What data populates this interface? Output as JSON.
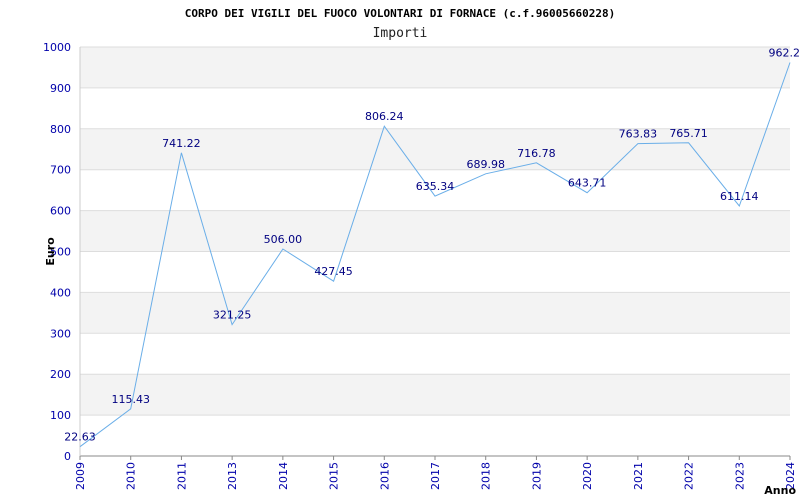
{
  "chart_data": {
    "type": "line",
    "title": "CORPO DEI VIGILI DEL FUOCO VOLONTARI DI FORNACE (c.f.96005660228)",
    "subtitle": "Importi",
    "xlabel": "Anno",
    "ylabel": "Euro",
    "categories": [
      "2009",
      "2010",
      "2011",
      "2013",
      "2014",
      "2015",
      "2016",
      "2017",
      "2018",
      "2019",
      "2020",
      "2021",
      "2022",
      "2023",
      "2024"
    ],
    "values": [
      22.63,
      115.43,
      741.22,
      321.25,
      506.0,
      427.45,
      806.24,
      635.34,
      689.98,
      716.78,
      643.71,
      763.83,
      765.71,
      611.14,
      962.2
    ],
    "value_labels": [
      "22.63",
      "115.43",
      "741.22",
      "321.25",
      "506.00",
      "427.45",
      "806.24",
      "635.34",
      "689.98",
      "716.78",
      "643.71",
      "763.83",
      "765.71",
      "611.14",
      "962.2"
    ],
    "ylim": [
      0,
      1000
    ],
    "yticks": [
      "0",
      "100",
      "200",
      "300",
      "400",
      "500",
      "600",
      "700",
      "800",
      "900",
      "1000"
    ],
    "grid": true,
    "colors": {
      "line": "#6aaee8",
      "band": "#f3f3f3",
      "grid": "#dddddd",
      "tick_text": "#0000aa",
      "value_text": "#000080"
    }
  }
}
